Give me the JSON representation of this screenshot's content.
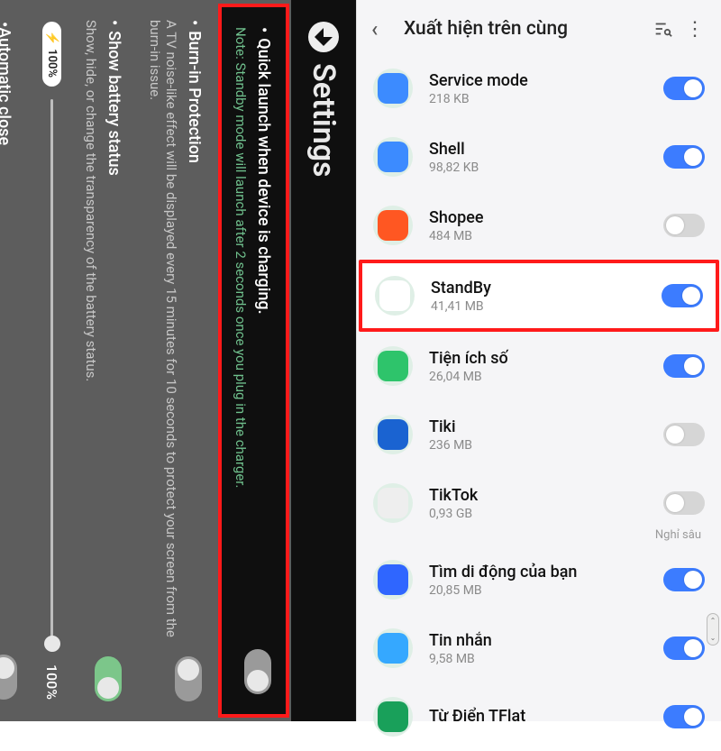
{
  "left": {
    "header_title": "Settings",
    "quick_launch": {
      "title": "Quick launch when device is charging.",
      "note": "Note: Standby mode will launch after 2 seconds once you plug in the charger."
    },
    "burn_in": {
      "title": "Burn-in Protection",
      "desc": "A TV noise-like effect will be displayed every 15 minutes for 10 seconds to protect your screen from the burn-in issue."
    },
    "battery": {
      "title": "Show battery status",
      "desc": "Show, hide, or change the transparency of the battery status."
    },
    "slider": {
      "pill": "100%",
      "pct": "100%"
    },
    "auto_close": {
      "title": "Automatic close"
    }
  },
  "right": {
    "header": "Xuất hiện trên cùng",
    "items": [
      {
        "name": "Service mode",
        "size": "218 KB",
        "on": true,
        "color": "#3c7cff",
        "icon_bg": "#3c8bff"
      },
      {
        "name": "Shell",
        "size": "98,82 KB",
        "on": true,
        "color": "#3c7cff",
        "icon_bg": "#3c8bff"
      },
      {
        "name": "Shopee",
        "size": "484 MB",
        "on": false,
        "color": "#d6d6d6",
        "icon_bg": "#ff5722"
      },
      {
        "name": "StandBy",
        "size": "41,41 MB",
        "on": true,
        "color": "#3c7cff",
        "icon_bg": "#ffffff",
        "highlight": true
      },
      {
        "name": "Tiện ích số",
        "size": "26,04 MB",
        "on": true,
        "color": "#3c7cff",
        "icon_bg": "#2ec46b"
      },
      {
        "name": "Tiki",
        "size": "236 MB",
        "on": false,
        "color": "#d6d6d6",
        "icon_bg": "#1a63d1"
      },
      {
        "name": "TikTok",
        "size": "0,93 GB",
        "on": false,
        "color": "#d6d6d6",
        "icon_bg": "#eeeeee",
        "sleep": "Nghỉ sâu"
      },
      {
        "name": "Tìm di động của bạn",
        "size": "20,85 MB",
        "on": true,
        "color": "#3c7cff",
        "icon_bg": "#2f66ff"
      },
      {
        "name": "Tin nhắn",
        "size": "9,58 MB",
        "on": true,
        "color": "#3c7cff",
        "icon_bg": "#35a8ff"
      },
      {
        "name": "Từ Điển TFlat",
        "size": "",
        "on": true,
        "color": "#3c7cff",
        "icon_bg": "#19a05a"
      }
    ]
  }
}
